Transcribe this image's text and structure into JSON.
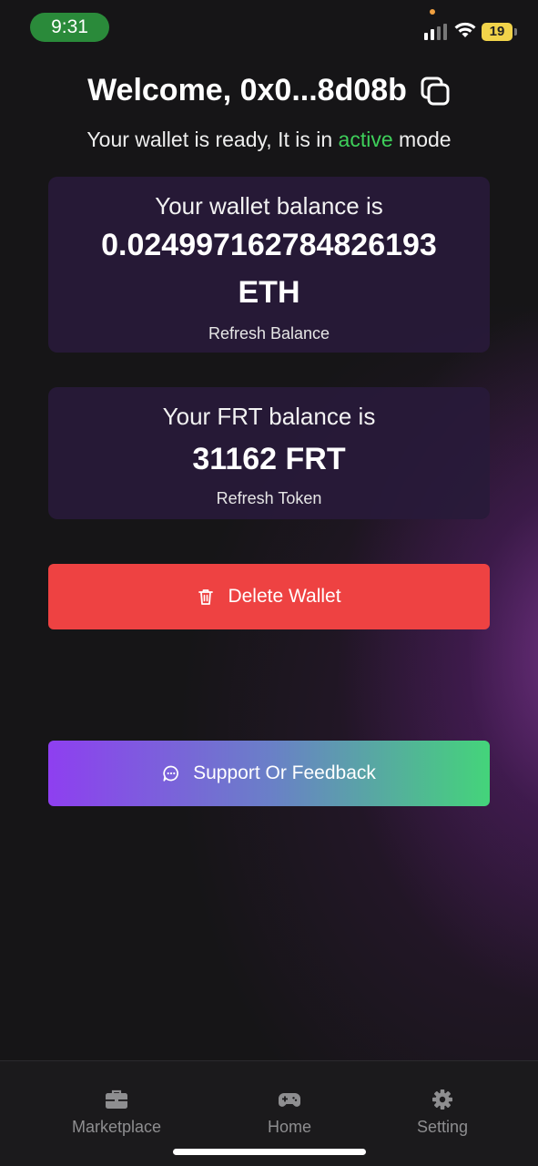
{
  "status_bar": {
    "time": "9:31",
    "battery_level": "19",
    "icons": [
      "signal-icon",
      "wifi-icon",
      "battery-icon"
    ]
  },
  "header": {
    "welcome": "Welcome, 0x0...8d08b",
    "subtitle_prefix": "Your wallet is ready, It is in ",
    "subtitle_status": "active",
    "subtitle_suffix": " mode"
  },
  "eth_card": {
    "label": "Your wallet balance is",
    "amount": "0.024997162784826193",
    "unit": "ETH",
    "action": "Refresh Balance"
  },
  "frt_card": {
    "label": "Your FRT balance is",
    "value": "31162 FRT",
    "action": "Refresh Token"
  },
  "buttons": {
    "delete": "Delete Wallet",
    "support": "Support Or Feedback"
  },
  "nav": {
    "items": [
      {
        "label": "Marketplace",
        "icon": "briefcase-icon"
      },
      {
        "label": "Home",
        "icon": "gamepad-icon"
      },
      {
        "label": "Setting",
        "icon": "gear-icon"
      }
    ]
  },
  "colors": {
    "background": "#161517",
    "card": "#281a3a",
    "active": "#3ecf5a",
    "delete": "#ee4242",
    "support_start": "#8e3ff0",
    "support_end": "#44d47a",
    "nav_text": "#8e8e90"
  }
}
